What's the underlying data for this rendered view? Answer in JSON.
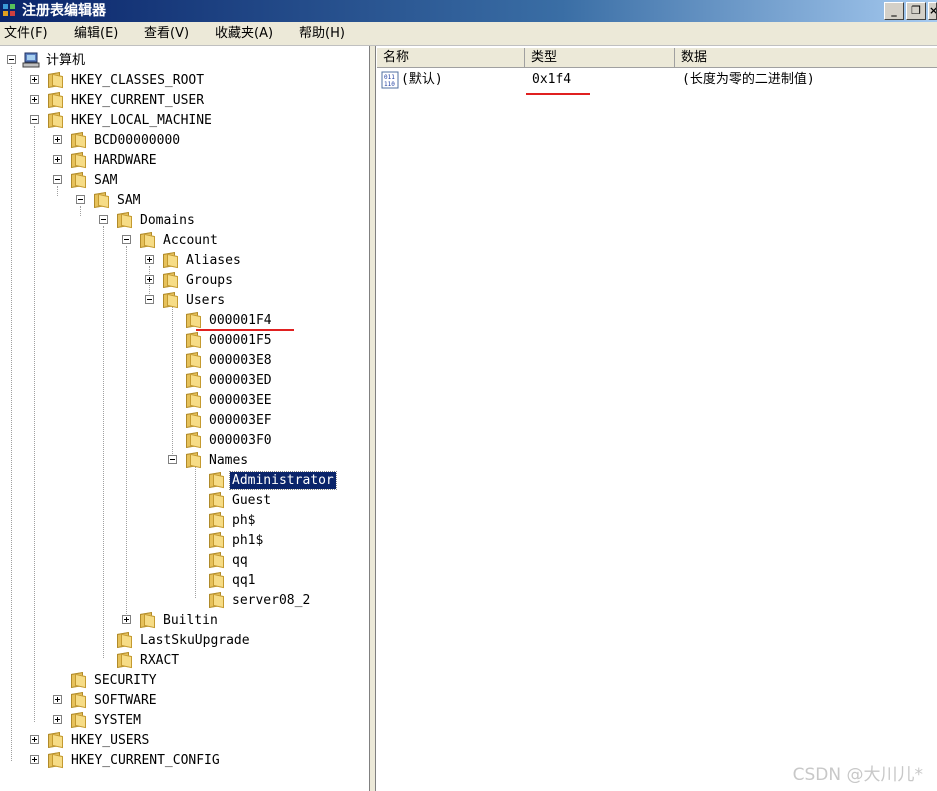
{
  "window": {
    "title": "注册表编辑器",
    "min_label": "_",
    "restore_label": "❐",
    "close_label": "×"
  },
  "menu": [
    "文件(F)",
    "编辑(E)",
    "查看(V)",
    "收藏夹(A)",
    "帮助(H)"
  ],
  "tree": {
    "root": "计算机",
    "hkcr": "HKEY_CLASSES_ROOT",
    "hkcu": "HKEY_CURRENT_USER",
    "hklm": "HKEY_LOCAL_MACHINE",
    "bcd": "BCD00000000",
    "hardware": "HARDWARE",
    "sam": "SAM",
    "sam_sub": "SAM",
    "domains": "Domains",
    "account": "Account",
    "aliases": "Aliases",
    "groups": "Groups",
    "users": "Users",
    "user_keys": [
      "000001F4",
      "000001F5",
      "000003E8",
      "000003ED",
      "000003EE",
      "000003EF",
      "000003F0"
    ],
    "names": "Names",
    "name_keys": [
      "Administrator",
      "Guest",
      "ph$",
      "ph1$",
      "qq",
      "qq1",
      "server08_2"
    ],
    "builtin": "Builtin",
    "lastsku": "LastSkuUpgrade",
    "rxact": "RXACT",
    "security": "SECURITY",
    "software": "SOFTWARE",
    "system": "SYSTEM",
    "hku": "HKEY_USERS",
    "hkcc": "HKEY_CURRENT_CONFIG"
  },
  "list": {
    "columns": [
      "名称",
      "类型",
      "数据"
    ],
    "rows": [
      {
        "name": "(默认)",
        "type": "0x1f4",
        "data": "(长度为零的二进制值)"
      }
    ]
  },
  "watermark": "CSDN @大川儿*",
  "colors": {
    "underline": "#e02020",
    "selection": "#0a246a",
    "titlebar": "#0a246a"
  }
}
